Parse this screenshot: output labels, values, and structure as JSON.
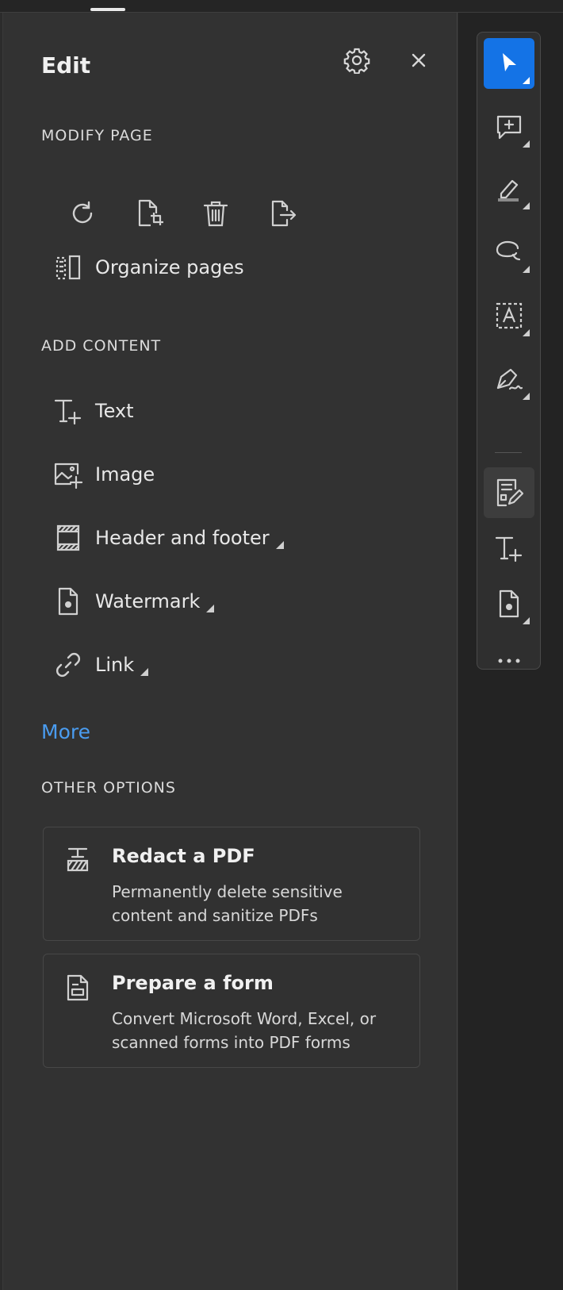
{
  "panel": {
    "title": "Edit",
    "settings_icon": "gear-icon",
    "close_icon": "close-icon"
  },
  "modify_page": {
    "label": "MODIFY PAGE",
    "tools": [
      {
        "name": "rotate-icon"
      },
      {
        "name": "crop-page-icon"
      },
      {
        "name": "delete-icon"
      },
      {
        "name": "extract-icon"
      }
    ],
    "organize_label": "Organize pages"
  },
  "add_content": {
    "label": "ADD CONTENT",
    "items": [
      {
        "label": "Text",
        "icon": "add-text-icon",
        "submenu": false
      },
      {
        "label": "Image",
        "icon": "add-image-icon",
        "submenu": false
      },
      {
        "label": "Header and footer",
        "icon": "header-footer-icon",
        "submenu": true
      },
      {
        "label": "Watermark",
        "icon": "watermark-icon",
        "submenu": true
      },
      {
        "label": "Link",
        "icon": "link-icon",
        "submenu": true
      }
    ],
    "more_label": "More"
  },
  "other_options": {
    "label": "OTHER OPTIONS",
    "cards": [
      {
        "title": "Redact a PDF",
        "desc": "Permanently delete sensitive content and sanitize PDFs",
        "icon": "redact-icon"
      },
      {
        "title": "Prepare a form",
        "desc": "Convert Microsoft Word, Excel, or scanned forms into PDF forms",
        "icon": "form-icon"
      }
    ]
  },
  "toolbar": {
    "tools": [
      "select-cursor-icon",
      "add-comment-icon",
      "highlight-icon",
      "draw-lasso-icon",
      "text-recognition-icon",
      "sign-icon",
      "edit-pdf-icon",
      "add-text-icon",
      "watermark-icon",
      "more-icon"
    ]
  },
  "colors": {
    "accent": "#1473e6",
    "link": "#4a9cf0",
    "panel_bg": "#323232"
  }
}
